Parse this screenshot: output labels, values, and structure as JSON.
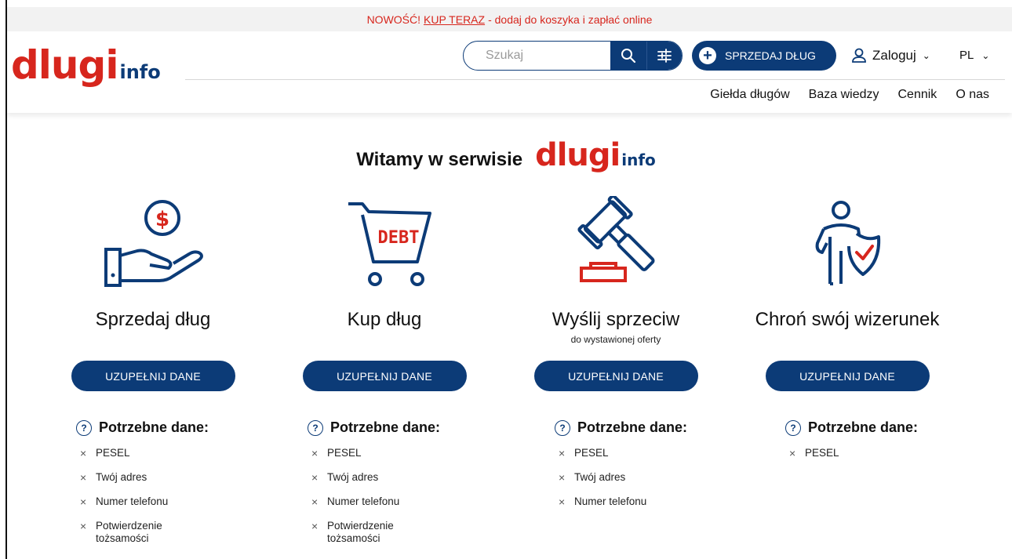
{
  "promo": {
    "prefix": "NOWOŚĆ!",
    "link": "KUP TERAZ",
    "suffix": "- dodaj do koszyka i zapłać online"
  },
  "header": {
    "logo_main": "dlugi",
    "logo_sub": "info",
    "search_placeholder": "Szukaj",
    "sell_button": "SPRZEDAJ DŁUG",
    "login_label": "Zaloguj",
    "language": "PL",
    "nav": [
      "Giełda długów",
      "Baza wiedzy",
      "Cennik",
      "O nas"
    ]
  },
  "welcome": {
    "text": "Witamy w serwisie",
    "logo_main": "dlugi",
    "logo_sub": "info"
  },
  "colors": {
    "brand_red": "#d7261d",
    "brand_navy": "#0c3b77"
  },
  "needs_heading": "Potrzebne dane:",
  "cards": [
    {
      "icon": "hand-dollar-icon",
      "title": "Sprzedaj dług",
      "subtitle": "",
      "cta": "UZUPEŁNIJ DANE",
      "requirements": [
        "PESEL",
        "Twój adres",
        "Numer telefonu",
        "Potwierdzenie tożsamości"
      ]
    },
    {
      "icon": "debt-cart-icon",
      "title": "Kup dług",
      "subtitle": "",
      "cta": "UZUPEŁNIJ DANE",
      "cart_text": "DEBT",
      "requirements": [
        "PESEL",
        "Twój adres",
        "Numer telefonu",
        "Potwierdzenie tożsamości"
      ]
    },
    {
      "icon": "gavel-icon",
      "title": "Wyślij sprzeciw",
      "subtitle": "do wystawionej oferty",
      "cta": "UZUPEŁNIJ DANE",
      "requirements": [
        "PESEL",
        "Twój adres",
        "Numer telefonu"
      ]
    },
    {
      "icon": "person-shield-icon",
      "title": "Chroń swój wizerunek",
      "subtitle": "",
      "cta": "UZUPEŁNIJ DANE",
      "requirements": [
        "PESEL"
      ]
    }
  ]
}
